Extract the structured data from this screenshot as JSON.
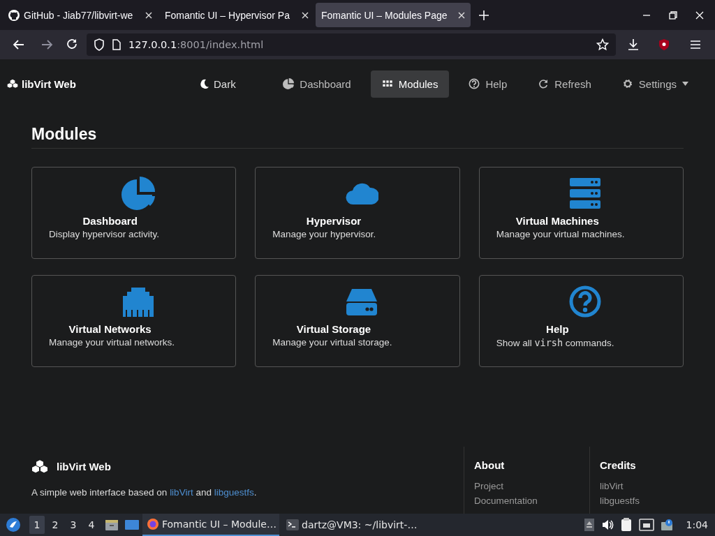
{
  "browser": {
    "tabs": [
      {
        "title": "GitHub - Jiab77/libvirt-we",
        "selected": false
      },
      {
        "title": "Fomantic UI – Hypervisor Pa",
        "selected": false
      },
      {
        "title": "Fomantic UI – Modules Page",
        "selected": true
      }
    ],
    "url_host": "127.0.0.1",
    "url_rest": ":8001/index.html"
  },
  "navbar": {
    "brand": "libVirt Web",
    "theme_toggle": "Dark",
    "items": [
      {
        "label": "Dashboard",
        "kind": "pie",
        "selected": false
      },
      {
        "label": "Modules",
        "kind": "grid",
        "selected": true
      },
      {
        "label": "Help",
        "kind": "question",
        "selected": false
      },
      {
        "label": "Refresh",
        "kind": "refresh",
        "selected": false
      },
      {
        "label": "Settings",
        "kind": "gear",
        "selected": false,
        "dropdown": true
      }
    ]
  },
  "page": {
    "title": "Modules",
    "cards": [
      {
        "kind": "pie",
        "title": "Dashboard",
        "description": [
          {
            "kind": "text",
            "text": "Display hypervisor activity."
          }
        ]
      },
      {
        "kind": "cloud",
        "title": "Hypervisor",
        "description": [
          {
            "kind": "text",
            "text": "Manage your hypervisor."
          }
        ]
      },
      {
        "kind": "server",
        "title": "Virtual Machines",
        "description": [
          {
            "kind": "text",
            "text": "Manage your virtual machines."
          }
        ]
      },
      {
        "kind": "ethernet",
        "title": "Virtual Networks",
        "description": [
          {
            "kind": "text",
            "text": "Manage your virtual networks."
          }
        ]
      },
      {
        "kind": "hdd",
        "title": "Virtual Storage",
        "description": [
          {
            "kind": "text",
            "text": "Manage your virtual storage."
          }
        ]
      },
      {
        "kind": "question",
        "title": "Help",
        "description": [
          {
            "kind": "text",
            "text": "Show all "
          },
          {
            "kind": "code",
            "text": "virsh"
          },
          {
            "kind": "text",
            "text": " commands."
          }
        ]
      }
    ]
  },
  "footer": {
    "brand": "libVirt Web",
    "tagline": [
      {
        "kind": "text",
        "text": "A simple web interface based on "
      },
      {
        "kind": "link",
        "text": "libVirt"
      },
      {
        "kind": "text",
        "text": " and "
      },
      {
        "kind": "link",
        "text": "libguestfs"
      },
      {
        "kind": "text",
        "text": "."
      }
    ],
    "columns": [
      {
        "heading": "About",
        "links": [
          "Project",
          "Documentation"
        ]
      },
      {
        "heading": "Credits",
        "links": [
          "libVirt",
          "libguestfs"
        ]
      }
    ]
  },
  "taskbar": {
    "workspaces": [
      {
        "label": "1",
        "selected": true
      },
      {
        "label": "2",
        "selected": false
      },
      {
        "label": "3",
        "selected": false
      },
      {
        "label": "4",
        "selected": false
      }
    ],
    "windows": [
      {
        "title": "Fomantic UI – Module…",
        "kind": "browser",
        "selected": true
      },
      {
        "title": "dartz@VM3: ~/libvirt-…",
        "kind": "terminal",
        "selected": false
      }
    ],
    "clock": "1:04"
  }
}
